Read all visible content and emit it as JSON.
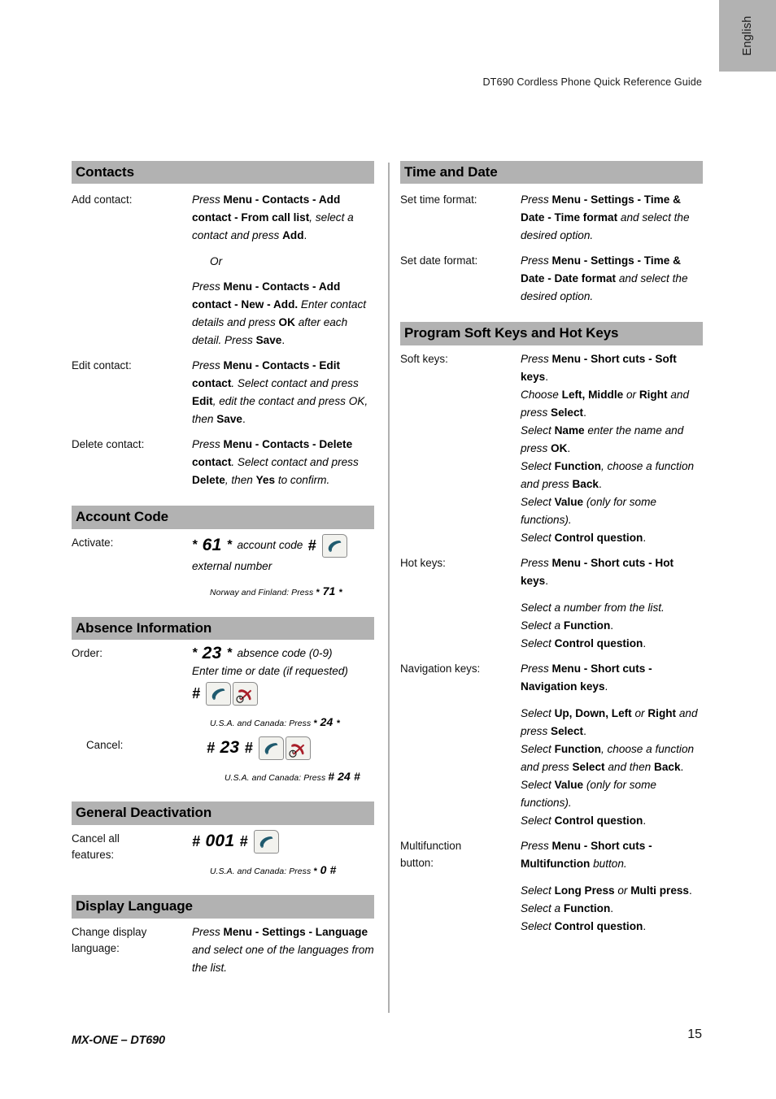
{
  "header": {
    "language_tab": "English",
    "running_head": "DT690 Cordless Phone Quick Reference Guide"
  },
  "footer": {
    "document": "MX-ONE – DT690",
    "page_number": "15"
  },
  "colors": {
    "section_header_bg": "#b2b2b2",
    "divider": "#b0b0b0",
    "offhook_icon": "#1f5a6e",
    "onhook_icon": "#a81d28",
    "key_face": "#f2f2ee",
    "key_border": "#8c8c8c"
  },
  "left_column": {
    "contacts": {
      "title": "Contacts",
      "add_contact": {
        "label": "Add contact:",
        "part1_a": "Press ",
        "part1_b": "Menu - Contacts - Add contact - From call list",
        "part1_c": ", select a contact and press ",
        "part1_d": "Add",
        "part1_e": ".",
        "or": "Or",
        "part2_a": "Press ",
        "part2_b": "Menu - Contacts - Add contact - New - Add.",
        "part2_c": " Enter contact details and press ",
        "part2_d": "OK",
        "part2_e": " after each detail. Press ",
        "part2_f": "Save",
        "part2_g": "."
      },
      "edit_contact": {
        "label": "Edit contact:",
        "a": "Press ",
        "b": "Menu - Contacts - Edit contact",
        "c": ". Select contact and press ",
        "d": "Edit",
        "e": ", edit the contact and press OK, then ",
        "f": "Save",
        "g": "."
      },
      "delete_contact": {
        "label": "Delete contact:",
        "a": "Press ",
        "b": "Menu - Contacts - Delete contact",
        "c": ". Select contact and press ",
        "d": "Delete",
        "e": ", then ",
        "f": "Yes",
        "g": " to confirm."
      }
    },
    "account_code": {
      "title": "Account Code",
      "activate": {
        "label": "Activate:",
        "code_star1": "*",
        "code_num": "61",
        "code_star2": "*",
        "code_text": "account code",
        "code_hash": "#",
        "icon": "offhook-key-icon",
        "subline": "external number",
        "note_prefix": "Norway and Finland: Press ",
        "note_star1": "*",
        "note_code": "71",
        "note_star2": "*"
      }
    },
    "absence_information": {
      "title": "Absence Information",
      "order": {
        "label": "Order:",
        "code_star1": "*",
        "code_num": "23",
        "code_star2": "*",
        "code_text": "absence code (0-9)",
        "subline": "Enter time or date (if requested)",
        "code_hash": "#",
        "icon_offhook": "offhook-key-icon",
        "icon_onhook": "onhook-key-icon",
        "note_prefix": "U.S.A. and Canada: Press ",
        "note_star1": "*",
        "note_code": "24",
        "note_star2": "*"
      },
      "cancel": {
        "label": "Cancel:",
        "code_hash1": "#",
        "code_num": "23",
        "code_hash2": "#",
        "icon_offhook": "offhook-key-icon",
        "icon_onhook": "onhook-key-icon",
        "note_prefix": "U.S.A. and Canada: Press ",
        "note_hash1": "#",
        "note_code": "24",
        "note_hash2": "#"
      }
    },
    "general_deactivation": {
      "title": "General Deactivation",
      "cancel_all": {
        "label_line1": "Cancel all",
        "label_line2": "features:",
        "code_hash1": "#",
        "code_num": "001",
        "code_hash2": "#",
        "icon": "offhook-key-icon",
        "note_prefix": "U.S.A. and Canada: Press ",
        "note_star": "*",
        "note_code": "0",
        "note_hash": "#"
      }
    },
    "display_language": {
      "title": "Display Language",
      "change_language": {
        "label_line1": "Change display",
        "label_line2": "language:",
        "a": "Press ",
        "b": "Menu - Settings - Language",
        "c": " and select one of the languages from the list."
      }
    }
  },
  "right_column": {
    "time_and_date": {
      "title": "Time and Date",
      "set_time_format": {
        "label": "Set time format:",
        "a": "Press ",
        "b": "Menu - Settings - Time & Date - Time format",
        "c": " and select the desired option."
      },
      "set_date_format": {
        "label": "Set date format:",
        "a": "Press ",
        "b": "Menu - Settings - Time & Date - Date format",
        "c": " and select the desired option."
      }
    },
    "program_keys": {
      "title": "Program Soft Keys and Hot Keys",
      "soft_keys": {
        "label": "Soft keys:",
        "l1_a": "Press ",
        "l1_b": "Menu - Short cuts - Soft keys",
        "l1_c": ".",
        "l2_a": "Choose ",
        "l2_b": "Left, Middle",
        "l2_c": " or ",
        "l2_d": "Right",
        "l2_e": " and press ",
        "l2_f": "Select",
        "l2_g": ".",
        "l3_a": "Select ",
        "l3_b": "Name",
        "l3_c": " enter the name and press ",
        "l3_d": "OK",
        "l3_e": ".",
        "l4_a": "Select ",
        "l4_b": "Function",
        "l4_c": ", choose a function and press ",
        "l4_d": "Back",
        "l4_e": ".",
        "l5_a": "Select ",
        "l5_b": "Value",
        "l5_c": " (only for some functions).",
        "l6_a": "Select ",
        "l6_b": "Control question",
        "l6_c": "."
      },
      "hot_keys": {
        "label": "Hot keys:",
        "l1_a": "Press ",
        "l1_b": "Menu - Short cuts - Hot keys",
        "l1_c": ".",
        "l2": "Select a number from the list.",
        "l3_a": "Select a ",
        "l3_b": "Function",
        "l3_c": ".",
        "l4_a": "Select ",
        "l4_b": "Control question",
        "l4_c": "."
      },
      "navigation_keys": {
        "label": "Navigation keys:",
        "l1_a": "Press ",
        "l1_b": "Menu - Short cuts - Navigation keys",
        "l1_c": ".",
        "l2_a": "Select ",
        "l2_b": "Up, Down, Left",
        "l2_c": " or ",
        "l2_d": "Right",
        "l2_e": " and press ",
        "l2_f": "Select",
        "l2_g": ".",
        "l3_a": "Select ",
        "l3_b": "Function",
        "l3_c": ", choose a function and press ",
        "l3_d": "Select",
        "l3_e": " and then ",
        "l3_f": "Back",
        "l3_g": ".",
        "l4_a": "Select ",
        "l4_b": "Value",
        "l4_c": " (only for some functions).",
        "l5_a": "Select ",
        "l5_b": "Control question",
        "l5_c": "."
      },
      "multifunction_button": {
        "label_line1": "Multifunction",
        "label_line2": "button:",
        "l1_a": "Press ",
        "l1_b": "Menu - Short cuts - Multifunction",
        "l1_c": " button.",
        "l2_a": "Select ",
        "l2_b": "Long Press",
        "l2_c": " or ",
        "l2_d": "Multi press",
        "l2_e": ".",
        "l3_a": "Select a ",
        "l3_b": "Function",
        "l3_c": ".",
        "l4_a": "Select ",
        "l4_b": "Control question",
        "l4_c": "."
      }
    }
  }
}
